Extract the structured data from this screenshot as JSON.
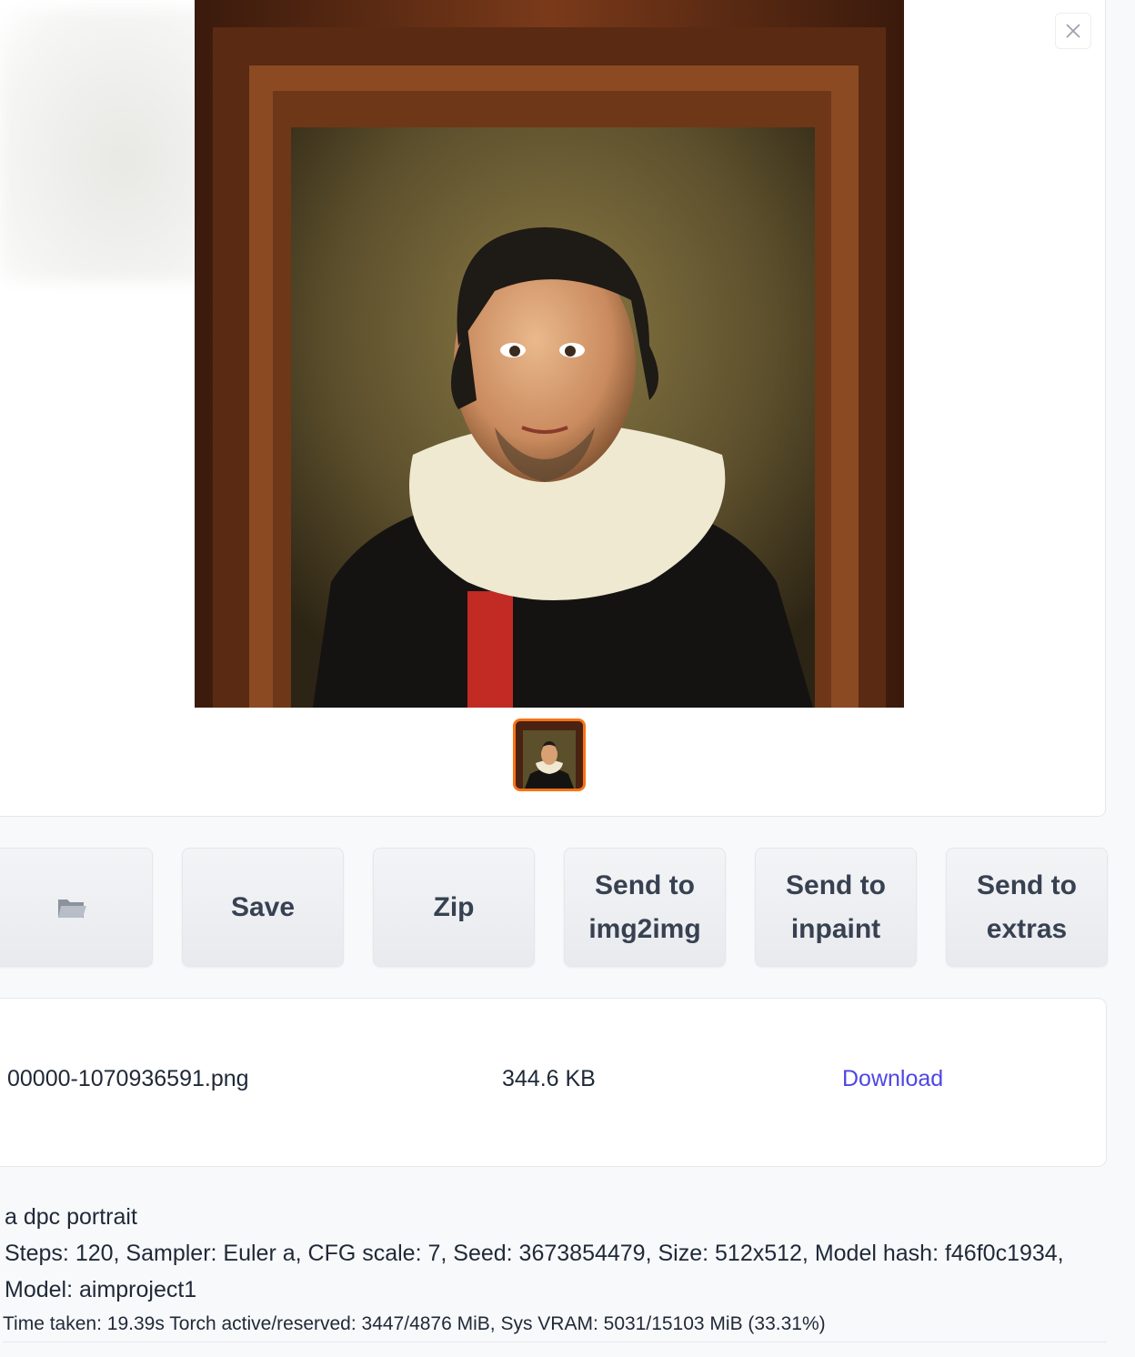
{
  "gallery": {
    "main_image_alt": "portrait painting",
    "thumbnail_count": 1
  },
  "actions": {
    "folder_icon": "folder-icon",
    "save_label": "Save",
    "zip_label": "Zip",
    "send_img2img_label": "Send to img2img",
    "send_inpaint_label": "Send to inpaint",
    "send_extras_label": "Send to extras"
  },
  "file": {
    "name": "00000-1070936591.png",
    "size": "344.6 KB",
    "download_label": "Download"
  },
  "generation_info": {
    "prompt": "a dpc portrait",
    "params": "Steps: 120, Sampler: Euler a, CFG scale: 7, Seed: 3673854479, Size: 512x512, Model hash: f46f0c1934, Model: aimproject1"
  },
  "performance": {
    "text": "Time taken: 19.39s  Torch active/reserved: 3447/4876 MiB, Sys VRAM: 5031/15103 MiB (33.31%)"
  },
  "colors": {
    "accent": "#f97316",
    "link": "#4f46e5"
  }
}
